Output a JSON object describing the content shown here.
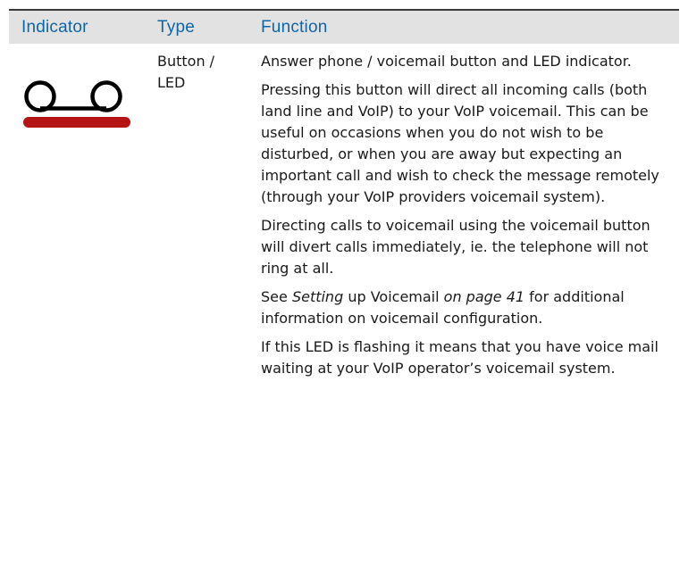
{
  "table": {
    "headers": {
      "indicator": "Indicator",
      "type": "Type",
      "function": "Function"
    },
    "row": {
      "icon": "voicemail-icon",
      "icon_color": "#000000",
      "led_color": "#b41414",
      "type": "Button /\nLED",
      "paragraphs": {
        "p1": "Answer phone / voicemail button and LED indicator.",
        "p2": "Pressing this button will direct all incoming calls (both land line and VoIP) to your VoIP voicemail. This can be useful on occasions when you do not wish to be disturbed, or when you are away but expecting an important call and wish to check the message remotely (through your VoIP providers voicemail system).",
        "p3": "Directing calls to voicemail using the voicemail button will divert calls immediately, ie. the telephone will not ring at all.",
        "p4": {
          "see": "See ",
          "setting": "Setting",
          "up_voicemail": " up Voicemail ",
          "page_ref": "on page 41",
          "rest": "  for additional information on voicemail configuration."
        },
        "p5": "If this LED is flashing it means that you have voice mail waiting at your VoIP operator’s voicemail system."
      }
    }
  },
  "colors": {
    "header_text": "#0d66a8",
    "header_bg": "#e2e2e2",
    "header_border": "#3a3a3a"
  }
}
